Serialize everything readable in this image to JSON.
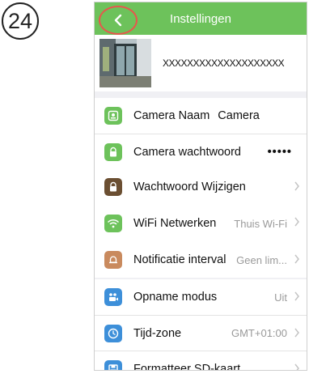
{
  "step": "24",
  "navbar": {
    "title": "Instellingen"
  },
  "profile": {
    "camera_id": "XXXXXXXXXXXXXXXXXXXX"
  },
  "colors": {
    "nav_green": "#6dc25b",
    "highlight_red": "#e8564c"
  },
  "settings": [
    {
      "label": "Camera Naam",
      "value": "Camera",
      "icon": "camera-icon",
      "icon_color": "#6dc25b"
    },
    {
      "label": "Camera wachtwoord",
      "value": "•••••",
      "icon": "lock-icon",
      "icon_color": "#6dc25b"
    },
    {
      "label": "Wachtwoord Wijzigen",
      "value": "",
      "icon": "lock-icon",
      "icon_color": "#6b4f32"
    },
    {
      "label": "WiFi Netwerken",
      "value": "Thuis Wi-Fi",
      "icon": "wifi-icon",
      "icon_color": "#6dc25b"
    },
    {
      "label": "Notificatie interval",
      "value": "Geen lim...",
      "icon": "bell-icon",
      "icon_color": "#c98a5e"
    },
    {
      "label": "Opname modus",
      "value": "Uit",
      "icon": "video-camera-icon",
      "icon_color": "#3d8fd9"
    },
    {
      "label": "Tijd-zone",
      "value": "GMT+01:00",
      "icon": "clock-icon",
      "icon_color": "#3d8fd9"
    },
    {
      "label": "Formatteer SD-kaart",
      "value": "",
      "icon": "save-icon",
      "icon_color": "#3d8fd9"
    }
  ]
}
